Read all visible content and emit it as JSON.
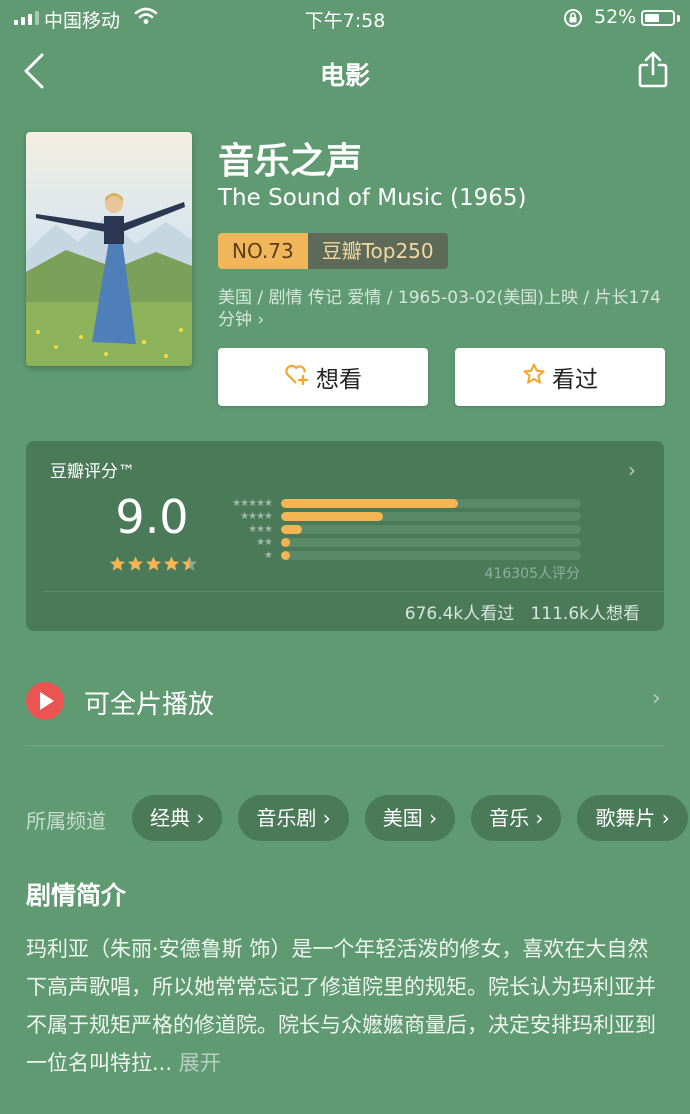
{
  "status": {
    "carrier": "中国移动",
    "time": "下午7:58",
    "battery_pct": "52%",
    "battery_level": 0.52
  },
  "nav": {
    "title": "电影"
  },
  "movie": {
    "poster_alt": "The Sound of Music",
    "title_cn": "音乐之声",
    "title_en": "The Sound of Music (1965)",
    "rank_no": "NO.73",
    "rank_list": "豆瓣Top250",
    "meta": "美国 / 剧情 传记 爱情 / 1965-03-02(美国)上映 / 片长174分钟 ›"
  },
  "buttons": {
    "want": "想看",
    "seen": "看过"
  },
  "rating": {
    "title": "豆瓣评分™",
    "score": "9.0",
    "stars": 4.5,
    "distribution": [
      {
        "stars": "★★★★★",
        "pct": 0.59
      },
      {
        "stars": "★★★★",
        "pct": 0.34
      },
      {
        "stars": "★★★",
        "pct": 0.07
      },
      {
        "stars": "★★",
        "pct": 0.03
      },
      {
        "stars": "★",
        "pct": 0.03
      }
    ],
    "count": "416305人评分",
    "watched": "676.4k人看过",
    "want": "111.6k人想看"
  },
  "play": {
    "label": "可全片播放"
  },
  "channels": {
    "label": "所属频道",
    "tags": [
      "经典 ›",
      "音乐剧 ›",
      "美国 ›",
      "音乐 ›",
      "歌舞片 ›"
    ]
  },
  "synopsis": {
    "title": "剧情简介",
    "text": "玛利亚（朱丽·安德鲁斯 饰）是一个年轻活泼的修女，喜欢在大自然下高声歌唱，所以她常常忘记了修道院里的规矩。院长认为玛利亚并不属于规矩严格的修道院。院长与众嬷嬷商量后，决定安排玛利亚到一位名叫特拉... ",
    "more": "展开"
  },
  "colors": {
    "accent": "#f5b553",
    "background": "#5f9a72",
    "play": "#ec5353"
  }
}
